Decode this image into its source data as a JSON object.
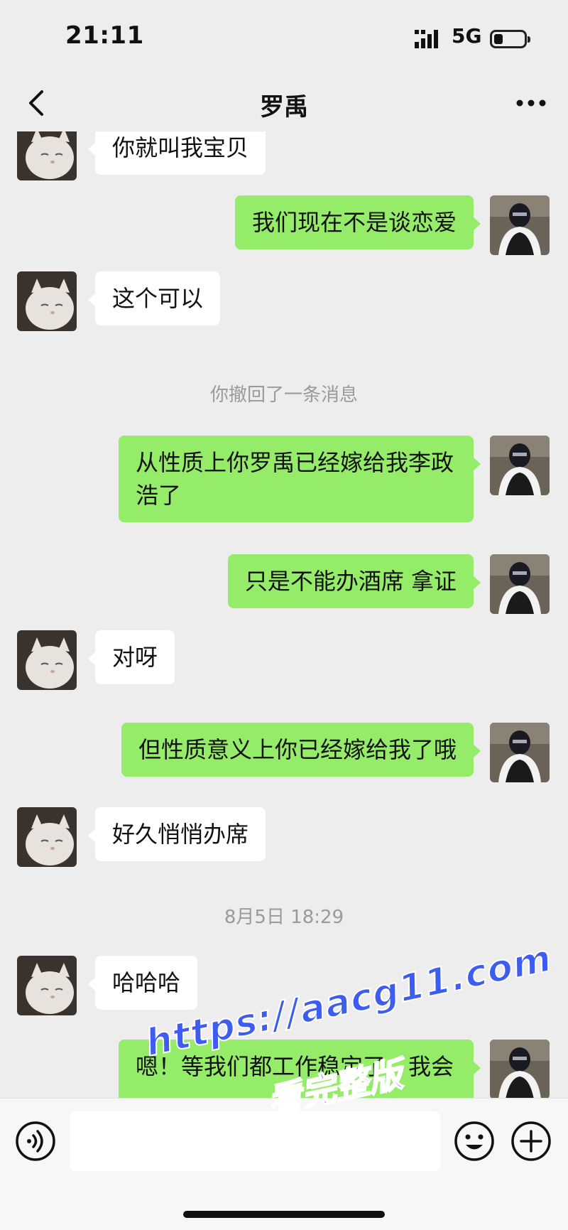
{
  "status_bar": {
    "time": "21:11",
    "network": "5G",
    "battery_level": 0.3
  },
  "nav": {
    "title": "罗禹",
    "back_icon": "chevron-left-icon",
    "more_icon": "more-dots-icon"
  },
  "messages": [
    {
      "side": "in",
      "text": "你就叫我宝贝"
    },
    {
      "side": "out",
      "text": "我们现在不是谈恋爱"
    },
    {
      "side": "in",
      "text": "这个可以"
    },
    {
      "side": "system",
      "text": "你撤回了一条消息"
    },
    {
      "side": "out",
      "text": "从性质上你罗禹已经嫁给我李政浩了"
    },
    {
      "side": "out",
      "text": "只是不能办酒席 拿证"
    },
    {
      "side": "in",
      "text": "对呀"
    },
    {
      "side": "out",
      "text": "但性质意义上你已经嫁给我了哦"
    },
    {
      "side": "in",
      "text": "好久悄悄办席"
    },
    {
      "side": "system",
      "text": "8月5日 18:29"
    },
    {
      "side": "in",
      "text": "哈哈哈"
    },
    {
      "side": "out",
      "text": "嗯！等我们都工作稳定了，我会"
    }
  ],
  "input_bar": {
    "placeholder": "",
    "voice_icon": "voice-icon",
    "emoji_icon": "emoji-icon",
    "plus_icon": "plus-icon"
  },
  "watermark": {
    "url": "https://aacg11.com",
    "text": "看完整版"
  },
  "colors": {
    "background": "#ededed",
    "outgoing_bubble": "#95ec69",
    "incoming_bubble": "#ffffff",
    "watermark": "#3d5cf0"
  }
}
